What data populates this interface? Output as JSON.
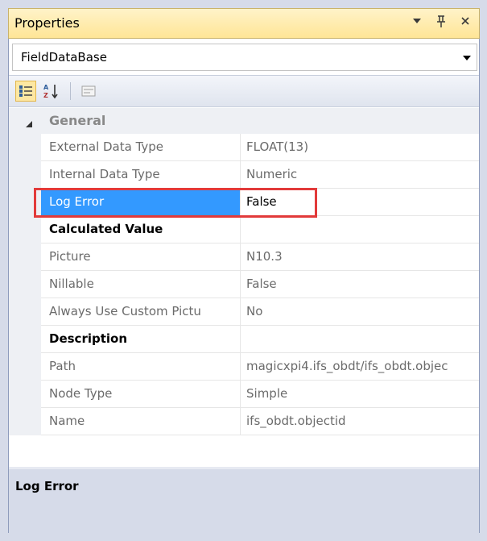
{
  "window": {
    "title": "Properties"
  },
  "selector": {
    "value": "FieldDataBase"
  },
  "toolbar": {
    "buttons": [
      {
        "name": "categorized-icon"
      },
      {
        "name": "alphabetical-sort-icon"
      },
      {
        "name": "property-pages-icon"
      }
    ]
  },
  "grid": {
    "category": "General",
    "rows": [
      {
        "name": "External Data Type",
        "value": "FLOAT(13)"
      },
      {
        "name": "Internal Data Type",
        "value": "Numeric"
      },
      {
        "name": "Log Error",
        "value": "False"
      },
      {
        "name": "Calculated  Value",
        "value": ""
      },
      {
        "name": "Picture",
        "value": "N10.3"
      },
      {
        "name": "Nillable",
        "value": "False"
      },
      {
        "name": "Always Use Custom Pictu",
        "value": "No"
      },
      {
        "name": "Description",
        "value": ""
      },
      {
        "name": "Path",
        "value": "magicxpi4.ifs_obdt/ifs_obdt.objec"
      },
      {
        "name": "Node Type",
        "value": "Simple"
      },
      {
        "name": "Name",
        "value": "ifs_obdt.objectid"
      }
    ]
  },
  "description": {
    "title": "Log Error"
  },
  "colors": {
    "selection": "#3399ff",
    "annotation": "#e23a3a",
    "titlebar": "#ffe596"
  }
}
